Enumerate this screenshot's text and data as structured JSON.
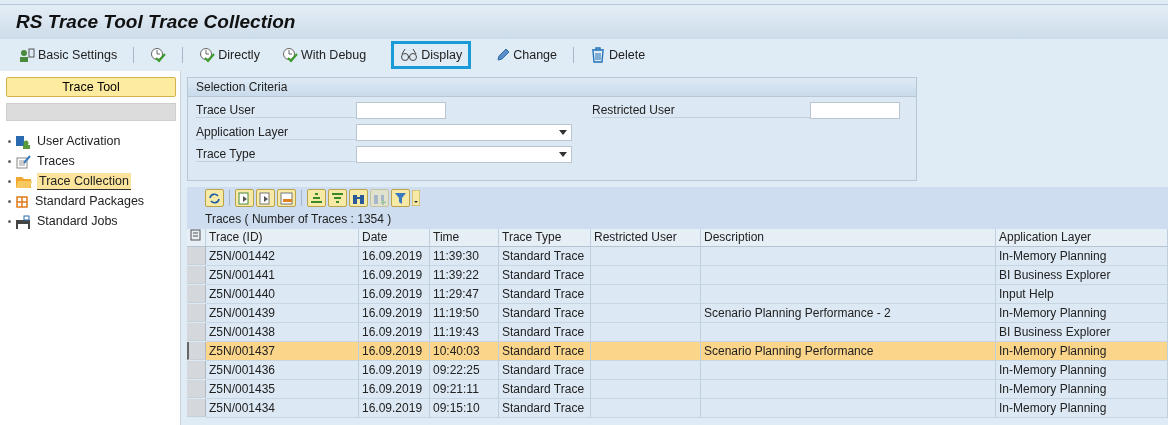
{
  "window": {
    "title": "RS Trace Tool Trace Collection"
  },
  "toolbar": [
    {
      "label": "Basic Settings",
      "selected": false
    },
    {
      "selected": false
    },
    {
      "label": "Directly",
      "selected": false
    },
    {
      "label": "With Debug",
      "selected": false
    },
    {
      "label": "Display",
      "selected": true
    },
    {
      "label": "Change",
      "selected": false
    },
    {
      "label": "Delete",
      "selected": false
    }
  ],
  "sidebar": {
    "header": "Trace Tool",
    "items": [
      {
        "label": "User Activation",
        "selected": false
      },
      {
        "label": "Traces",
        "selected": false
      },
      {
        "label": "Trace Collection",
        "selected": true
      },
      {
        "label": "Standard Packages",
        "selected": false
      },
      {
        "label": "Standard Jobs",
        "selected": false
      }
    ]
  },
  "selection": {
    "title": "Selection Criteria",
    "left_fields": [
      {
        "label": "Trace User",
        "kind": "text"
      },
      {
        "label": "Application Layer",
        "kind": "dropdown"
      },
      {
        "label": "Trace Type",
        "kind": "dropdown"
      }
    ],
    "right_fields": [
      {
        "label": "Restricted User",
        "kind": "text"
      }
    ]
  },
  "alv_toolbar": [
    {
      "disabled": false
    },
    {
      "disabled": false
    },
    {
      "disabled": false
    },
    {
      "disabled": false
    },
    {
      "disabled": false
    },
    {
      "disabled": false
    },
    {
      "disabled": false
    },
    {
      "disabled": true
    },
    {
      "disabled": false
    }
  ],
  "table": {
    "title": "Traces ( Number of Traces : 1354 )",
    "columns": [
      "Trace (ID)",
      "Date",
      "Time",
      "Trace Type",
      "Restricted User",
      "Description",
      "Application Layer"
    ],
    "rows": [
      {
        "selected": false,
        "cells": [
          "Z5N/001442",
          "16.09.2019",
          "11:39:30",
          "Standard Trace",
          "",
          "",
          "In-Memory Planning"
        ]
      },
      {
        "selected": false,
        "cells": [
          "Z5N/001441",
          "16.09.2019",
          "11:39:22",
          "Standard Trace",
          "",
          "",
          "BI Business Explorer"
        ]
      },
      {
        "selected": false,
        "cells": [
          "Z5N/001440",
          "16.09.2019",
          "11:29:47",
          "Standard Trace",
          "",
          "",
          "Input Help"
        ]
      },
      {
        "selected": false,
        "cells": [
          "Z5N/001439",
          "16.09.2019",
          "11:19:50",
          "Standard Trace",
          "",
          "Scenario Planning Performance - 2",
          "In-Memory Planning"
        ]
      },
      {
        "selected": false,
        "cells": [
          "Z5N/001438",
          "16.09.2019",
          "11:19:43",
          "Standard Trace",
          "",
          "",
          "BI Business Explorer"
        ]
      },
      {
        "selected": true,
        "cells": [
          "Z5N/001437",
          "16.09.2019",
          "10:40:03",
          "Standard Trace",
          "",
          "Scenario Planning Performance",
          "In-Memory Planning"
        ]
      },
      {
        "selected": false,
        "cells": [
          "Z5N/001436",
          "16.09.2019",
          "09:22:25",
          "Standard Trace",
          "",
          "",
          "In-Memory Planning"
        ]
      },
      {
        "selected": false,
        "cells": [
          "Z5N/001435",
          "16.09.2019",
          "09:21:11",
          "Standard Trace",
          "",
          "",
          "In-Memory Planning"
        ]
      },
      {
        "selected": false,
        "cells": [
          "Z5N/001434",
          "16.09.2019",
          "09:15:10",
          "Standard Trace",
          "",
          "",
          "In-Memory Planning"
        ]
      }
    ]
  }
}
